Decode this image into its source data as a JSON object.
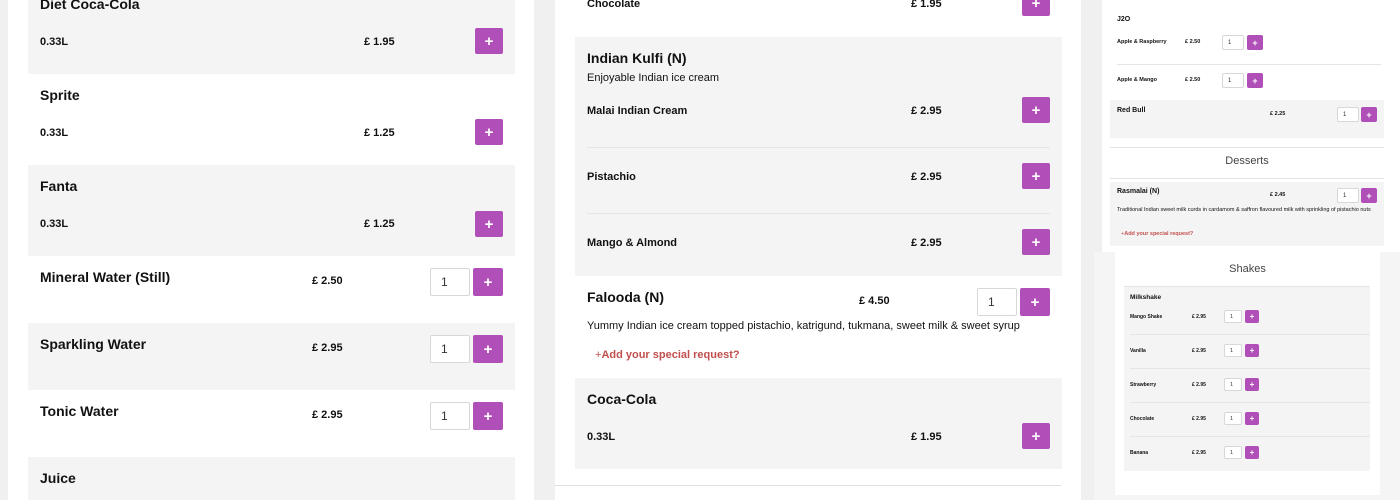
{
  "colors": {
    "accent": "#b14fb8",
    "link": "#c0504d",
    "row_alt": "#f4f4f4"
  },
  "left": {
    "diet_coke": {
      "name": "Diet Coca-Cola",
      "size": "0.33L",
      "price": "£ 1.95"
    },
    "sprite": {
      "name": "Sprite",
      "size": "0.33L",
      "price": "£ 1.25"
    },
    "fanta": {
      "name": "Fanta",
      "size": "0.33L",
      "price": "£ 1.25"
    },
    "mineral": {
      "name": "Mineral Water (Still)",
      "price": "£ 2.50",
      "qty": "1"
    },
    "sparkling": {
      "name": "Sparkling Water",
      "price": "£ 2.95",
      "qty": "1"
    },
    "tonic": {
      "name": "Tonic Water",
      "price": "£ 2.95",
      "qty": "1"
    },
    "juice": {
      "name": "Juice"
    }
  },
  "middle": {
    "chocolate": {
      "label": "Chocolate",
      "price": "£ 1.95"
    },
    "kulfi": {
      "name": "Indian Kulfi (N)",
      "desc": "Enjoyable Indian ice cream",
      "variants": [
        {
          "label": "Malai Indian Cream",
          "price": "£ 2.95"
        },
        {
          "label": "Pistachio",
          "price": "£ 2.95"
        },
        {
          "label": "Mango & Almond",
          "price": "£ 2.95"
        }
      ]
    },
    "falooda": {
      "name": "Falooda (N)",
      "price": "£ 4.50",
      "qty": "1",
      "desc": "Yummy Indian ice cream topped pistachio, katrigund, tukmana, sweet milk & sweet syrup",
      "special": "Add your special request?"
    },
    "coke": {
      "name": "Coca-Cola",
      "size": "0.33L",
      "price": "£ 1.95"
    }
  },
  "right": {
    "j2o": {
      "name": "J2O",
      "variants": [
        {
          "label": "Apple & Raspberry",
          "price": "£ 2.50",
          "qty": "1"
        },
        {
          "label": "Apple & Mango",
          "price": "£ 2.50",
          "qty": "1"
        }
      ]
    },
    "redbull": {
      "name": "Red Bull",
      "price": "£ 2.25",
      "qty": "1"
    },
    "desserts_heading": "Desserts",
    "rasmalai": {
      "name": "Rasmalai (N)",
      "price": "£ 2.45",
      "qty": "1",
      "desc": "Traditional Indian sweet milk curds in cardamom & saffron flavoured milk with sprinkling of pistachio nuts",
      "special": "Add your special request?"
    },
    "shakes_heading": "Shakes",
    "milkshake": {
      "name": "Milkshake",
      "variants": [
        {
          "label": "Mango Shake",
          "price": "£ 2.95",
          "qty": "1"
        },
        {
          "label": "Vanilla",
          "price": "£ 2.95",
          "qty": "1"
        },
        {
          "label": "Strawberry",
          "price": "£ 2.95",
          "qty": "1"
        },
        {
          "label": "Chocolate",
          "price": "£ 2.95",
          "qty": "1"
        },
        {
          "label": "Banana",
          "price": "£ 2.95",
          "qty": "1"
        }
      ]
    }
  },
  "icons": {
    "plus": "+"
  }
}
